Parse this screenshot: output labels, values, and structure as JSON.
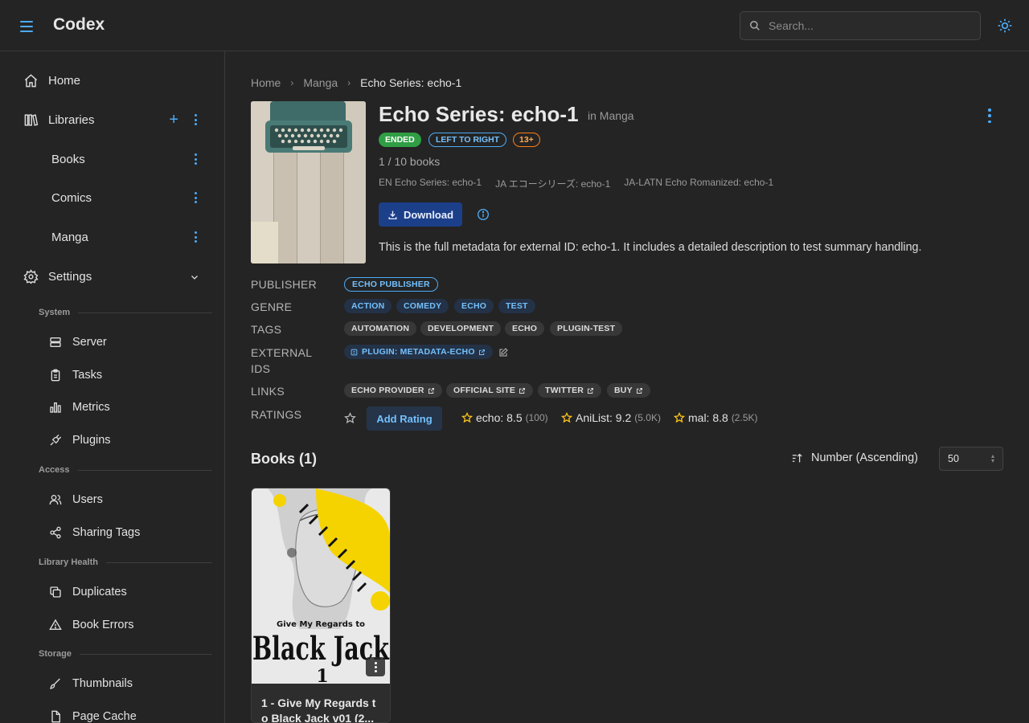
{
  "app": {
    "title": "Codex"
  },
  "search": {
    "placeholder": "Search..."
  },
  "sidebar": {
    "home": "Home",
    "libraries": "Libraries",
    "library_items": [
      "Books",
      "Comics",
      "Manga"
    ],
    "settings": "Settings",
    "sections": {
      "system": "System",
      "access": "Access",
      "library_health": "Library Health",
      "storage": "Storage"
    },
    "system_items": [
      "Server",
      "Tasks",
      "Metrics",
      "Plugins"
    ],
    "access_items": [
      "Users",
      "Sharing Tags"
    ],
    "health_items": [
      "Duplicates",
      "Book Errors"
    ],
    "storage_items": [
      "Thumbnails",
      "Page Cache"
    ]
  },
  "breadcrumb": {
    "home": "Home",
    "library": "Manga",
    "current": "Echo Series: echo-1"
  },
  "series": {
    "title": "Echo Series: echo-1",
    "in_library": "in Manga",
    "status": "ENDED",
    "reading_direction": "LEFT TO RIGHT",
    "age_rating": "13+",
    "book_count": "1 / 10 books",
    "alt_titles": [
      "EN Echo Series: echo-1",
      "JA エコーシリーズ: echo-1",
      "JA-LATN Echo Romanized: echo-1"
    ],
    "download_label": "Download",
    "summary": "This is the full metadata for external ID: echo-1. It includes a detailed description to test summary handling."
  },
  "metadata": {
    "publisher_label": "PUBLISHER",
    "publisher": "ECHO PUBLISHER",
    "genre_label": "GENRE",
    "genres": [
      "ACTION",
      "COMEDY",
      "ECHO",
      "TEST"
    ],
    "tags_label": "TAGS",
    "tags": [
      "AUTOMATION",
      "DEVELOPMENT",
      "ECHO",
      "PLUGIN-TEST"
    ],
    "external_ids_label_1": "EXTERNAL",
    "external_ids_label_2": "IDS",
    "external_id": "PLUGIN: METADATA-ECHO",
    "links_label": "LINKS",
    "links": [
      "ECHO PROVIDER",
      "OFFICIAL SITE",
      "TWITTER",
      "BUY"
    ],
    "ratings_label": "RATINGS",
    "add_rating": "Add Rating",
    "ratings": [
      {
        "source": "echo: 8.5",
        "count": "(100)"
      },
      {
        "source": "AniList: 9.2",
        "count": "(5.0K)"
      },
      {
        "source": "mal: 8.8",
        "count": "(2.5K)"
      }
    ]
  },
  "books": {
    "heading": "Books (1)",
    "sort_label": "Number (Ascending)",
    "per_page": "50",
    "items": [
      {
        "title": "1 - Give My Regards to Black Jack v01 (2...",
        "cover_text_top": "Give My Regards to",
        "cover_text_main": "Black Jack",
        "cover_volume": "1"
      }
    ]
  },
  "colors": {
    "accent": "#4dabf7",
    "background": "#242424",
    "ended": "#2f9e44",
    "age": "#fd7e14",
    "download": "#1c3f8a",
    "star": "#fcc419"
  }
}
